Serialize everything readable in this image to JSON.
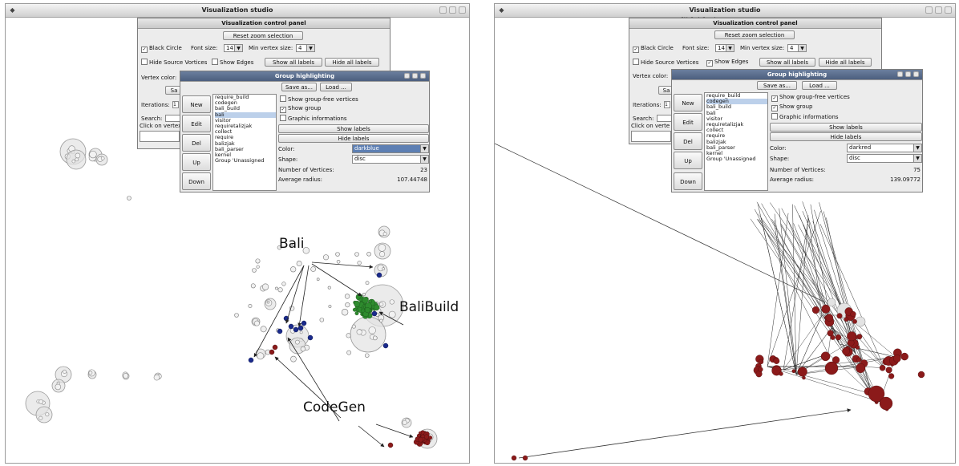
{
  "left_window": {
    "title": "Visualization studio",
    "control_panel": {
      "title": "Visualization control panel",
      "reset_zoom": "Reset zoom selection",
      "black_circle": "Black Circle",
      "font_size_label": "Font size:",
      "font_size_value": "14",
      "min_vertex_label": "Min vertex size:",
      "min_vertex_value": "4",
      "hide_source": "Hide Source Vortices",
      "show_edges": "Show Edges",
      "show_all_labels": "Show all labels",
      "hide_all_labels": "Hide all labels",
      "vertex_color": "Vertex color:",
      "save_stub": "Sa",
      "iterations": "Iterations:",
      "iterations_value": "1",
      "search": "Search:",
      "click_vertex": "Click on vertex"
    },
    "group_panel": {
      "title": "Group highlighting",
      "save_as": "Save as...",
      "load": "Load ...",
      "buttons": [
        "New",
        "Edit",
        "Del",
        "Up",
        "Down"
      ],
      "items": [
        "require_build",
        "codegen",
        "bali_build",
        "bali",
        "visitor",
        "requiretalizjak",
        "collect",
        "require",
        "balizjak",
        "bali_parser",
        "kernel",
        "Group 'Unassigned"
      ],
      "selected_index": 3,
      "show_group_free": "Show group-free vertices",
      "show_group": "Show group",
      "graphic_info": "Graphic informations",
      "show_labels": "Show labels",
      "hide_labels": "Hide labels",
      "color_label": "Color:",
      "color_value": "darkblue",
      "shape_label": "Shape:",
      "shape_value": "disc",
      "num_vertices_label": "Number of Vertices:",
      "num_vertices_value": "23",
      "avg_radius_label": "Average radius:",
      "avg_radius_value": "107.44748"
    },
    "annotations": {
      "bali": "Bali",
      "bali_build": "BaliBuild",
      "codegen": "CodeGen"
    }
  },
  "right_window": {
    "title": "Visualization studio",
    "control_panel": {
      "title": "Visualization control panel",
      "reset_zoom": "Reset zoom selection",
      "black_circle": "Black Circle",
      "font_size_label": "Font size:",
      "font_size_value": "14",
      "min_vertex_label": "Min vertex size:",
      "min_vertex_value": "4",
      "hide_source": "Hide Source Vertices",
      "show_edges": "Show Edges",
      "show_all_labels": "Show all labels",
      "hide_all_labels": "Hide all labels",
      "vertex_color": "Vertex color:",
      "save_stub": "Sa",
      "iterations": "Iterations:",
      "iterations_value": "1",
      "search": "Search:",
      "click_vertex": "Click on verte"
    },
    "group_panel": {
      "title": "Group highlighting",
      "save_as": "Save as...",
      "load": "Load ...",
      "buttons": [
        "New",
        "Edit",
        "Del",
        "Up",
        "Down"
      ],
      "items": [
        "require_build",
        "codegen",
        "bali_build",
        "bali",
        "visitor",
        "requiretalizjak",
        "collect",
        "require",
        "balizjak",
        "bali_parser",
        "kernel",
        "Group 'Unassigned"
      ],
      "selected_index": 1,
      "show_group_free": "Show group-free vertices",
      "show_group": "Show group",
      "graphic_info": "Graphic informations",
      "show_labels": "Show labels",
      "hide_labels": "Hide labels",
      "color_label": "Color:",
      "color_value": "darkred",
      "shape_label": "Shape:",
      "shape_value": "disc",
      "num_vertices_label": "Number of Vertices:",
      "num_vertices_value": "75",
      "avg_radius_label": "Average radius:",
      "avg_radius_value": "139.09772"
    }
  },
  "colors": {
    "darkblue": "#1a2a8c",
    "darkred": "#8b1a1a",
    "green": "#2e8b2e",
    "node_gray": "#e3e3e3"
  }
}
